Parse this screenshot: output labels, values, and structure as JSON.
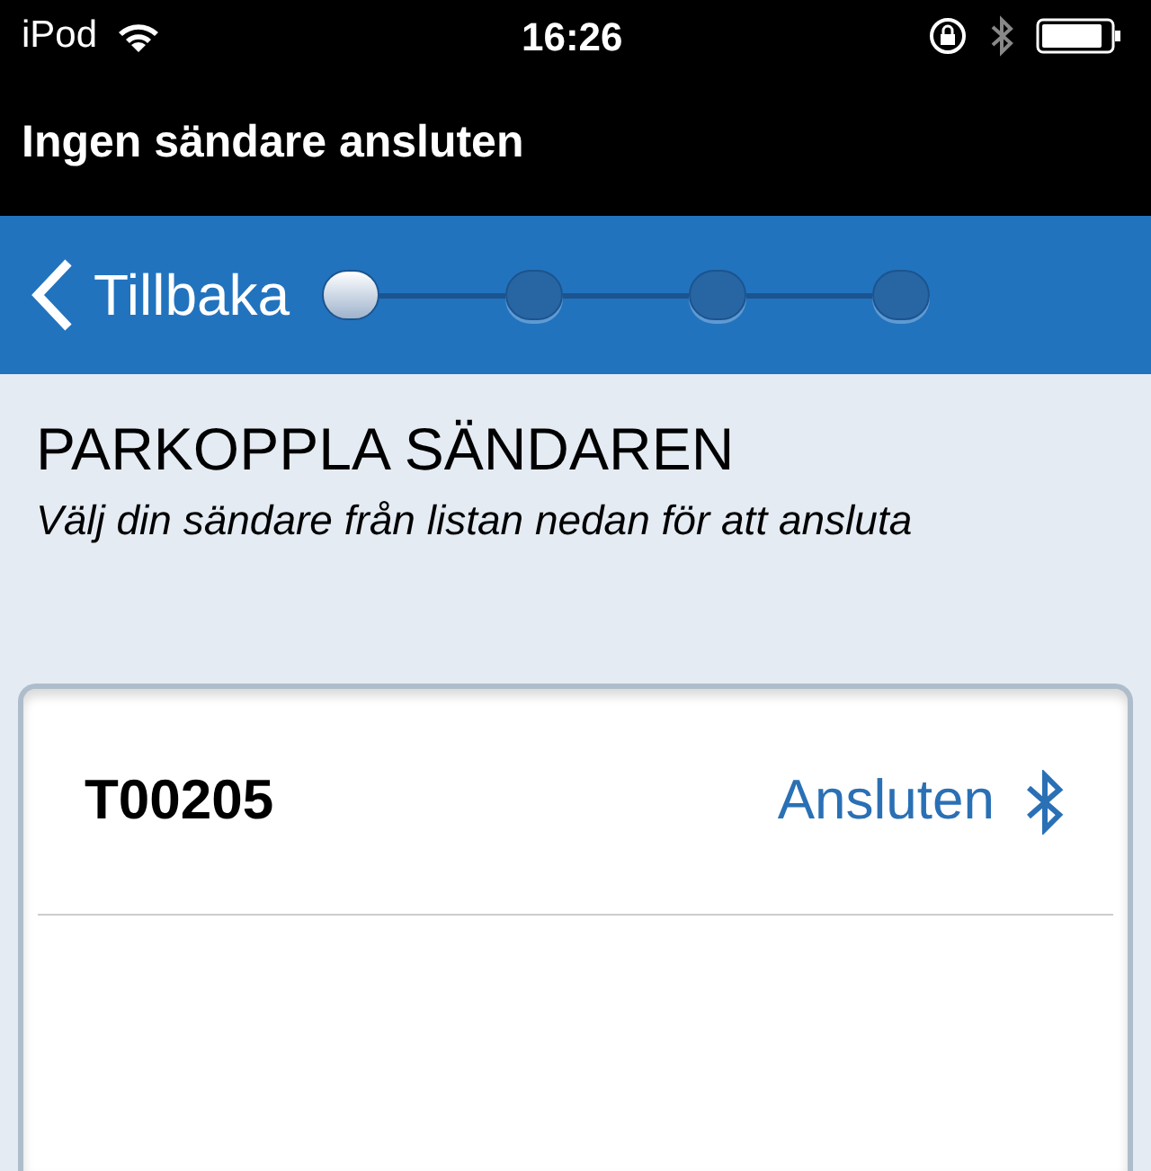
{
  "status_bar": {
    "carrier": "iPod",
    "time": "16:26"
  },
  "title": "Ingen sändare ansluten",
  "nav": {
    "back": "Tillbaka",
    "steps": [
      {
        "selected": true
      },
      {
        "selected": false
      },
      {
        "selected": false
      },
      {
        "selected": false
      }
    ]
  },
  "heading": "PARKOPPLA SÄNDAREN",
  "instruction": "Välj din sändare från listan nedan för att ansluta",
  "devices": [
    {
      "name": "T00205",
      "status": "Ansluten"
    }
  ]
}
